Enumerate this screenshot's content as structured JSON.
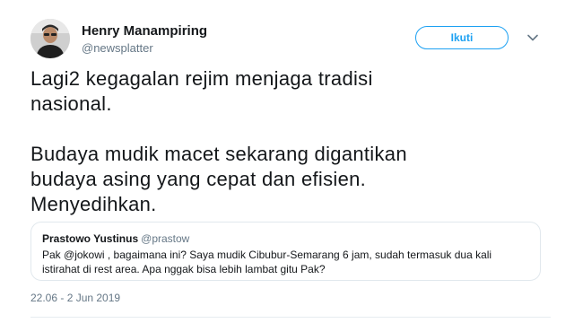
{
  "author": {
    "display_name": "Henry Manampiring",
    "handle": "@newsplatter"
  },
  "follow_button": {
    "label": "Ikuti"
  },
  "tweet": {
    "text": "Lagi2 kegagalan rejim menjaga tradisi\nnasional.\n\nBudaya mudik macet sekarang digantikan\nbudaya asing yang cepat dan efisien.\nMenyedihkan.",
    "timestamp": "22.06 - 2 Jun 2019"
  },
  "quoted_tweet": {
    "display_name": "Prastowo Yustinus",
    "handle": "@prastow",
    "text": "Pak @jokowi , bagaimana ini? Saya mudik Cibubur-Semarang 6 jam, sudah termasuk dua kali istirahat di rest area. Apa nggak bisa lebih lambat gitu Pak?"
  },
  "icons": {
    "avatar": "profile-photo",
    "caret": "chevron-down-icon"
  },
  "colors": {
    "accent": "#1da1f2",
    "secondary_text": "#657786",
    "border": "#e1e8ed"
  }
}
